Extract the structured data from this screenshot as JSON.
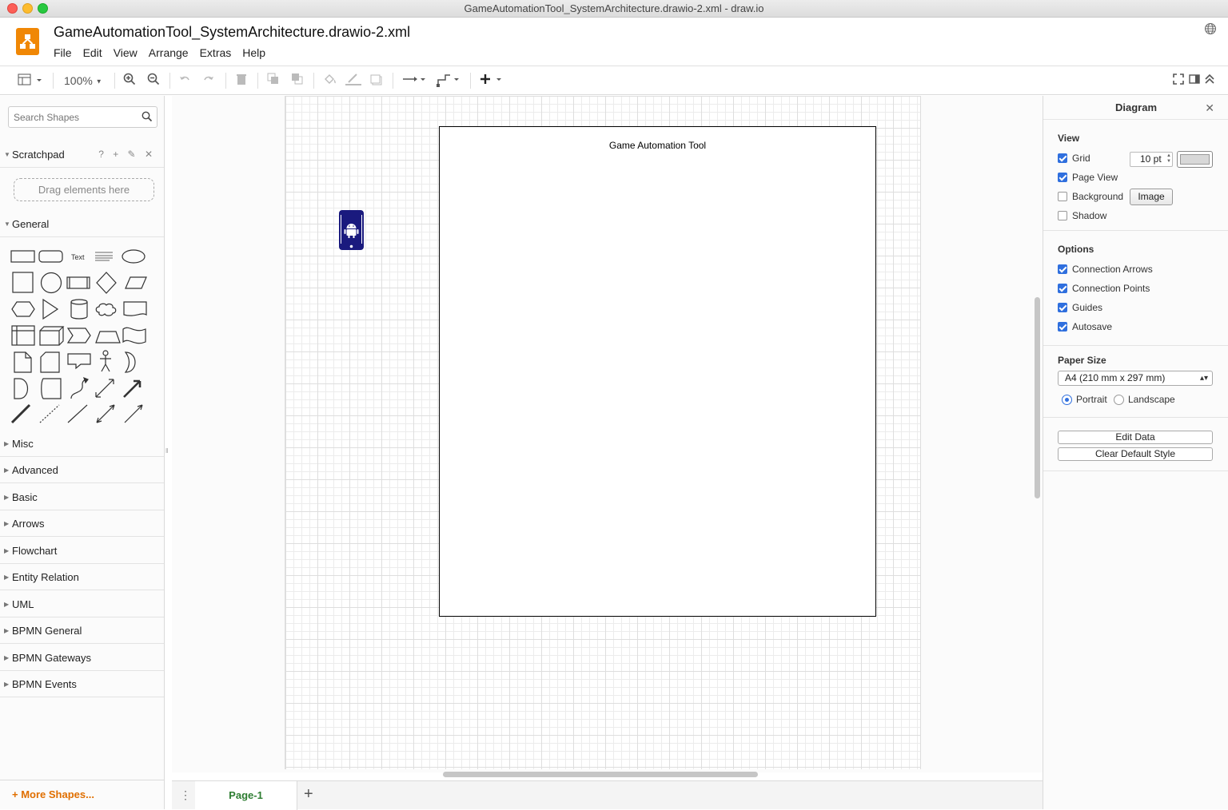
{
  "window": {
    "title": "GameAutomationTool_SystemArchitecture.drawio-2.xml - draw.io"
  },
  "app": {
    "doc_title": "GameAutomationTool_SystemArchitecture.drawio-2.xml",
    "menus": [
      "File",
      "Edit",
      "View",
      "Arrange",
      "Extras",
      "Help"
    ]
  },
  "toolbar": {
    "zoom": "100%"
  },
  "sidebar": {
    "search_placeholder": "Search Shapes",
    "scratchpad_label": "Scratchpad",
    "scratchpad_icons": "? + ✎ ✕",
    "drop_hint": "Drag elements here",
    "general_label": "General",
    "general_text_shape": "Text",
    "sections": [
      "Misc",
      "Advanced",
      "Basic",
      "Arrows",
      "Flowchart",
      "Entity Relation",
      "UML",
      "BPMN General",
      "BPMN Gateways",
      "BPMN Events"
    ],
    "more_shapes": "+ More Shapes..."
  },
  "canvas": {
    "container_label": "Game Automation Tool",
    "android_icon_name": "android-phone-icon"
  },
  "pages": {
    "tabs": [
      "Page-1"
    ]
  },
  "right_panel": {
    "title": "Diagram",
    "view_section": "View",
    "grid_label": "Grid",
    "grid_checked": true,
    "grid_size": "10 pt",
    "page_view_label": "Page View",
    "page_view_checked": true,
    "background_label": "Background",
    "background_checked": false,
    "image_button": "Image",
    "shadow_label": "Shadow",
    "shadow_checked": false,
    "options_section": "Options",
    "connection_arrows_label": "Connection Arrows",
    "connection_points_label": "Connection Points",
    "guides_label": "Guides",
    "autosave_label": "Autosave",
    "paper_size_section": "Paper Size",
    "paper_size_value": "A4 (210 mm x 297 mm)",
    "portrait_label": "Portrait",
    "landscape_label": "Landscape",
    "orientation": "Portrait",
    "edit_data_button": "Edit Data",
    "clear_style_button": "Clear Default Style"
  },
  "colors": {
    "accent": "#f08705",
    "page_tab_text": "#2e7d32",
    "checkbox": "#2f6fde",
    "android_shape": "#1a1a7e"
  }
}
